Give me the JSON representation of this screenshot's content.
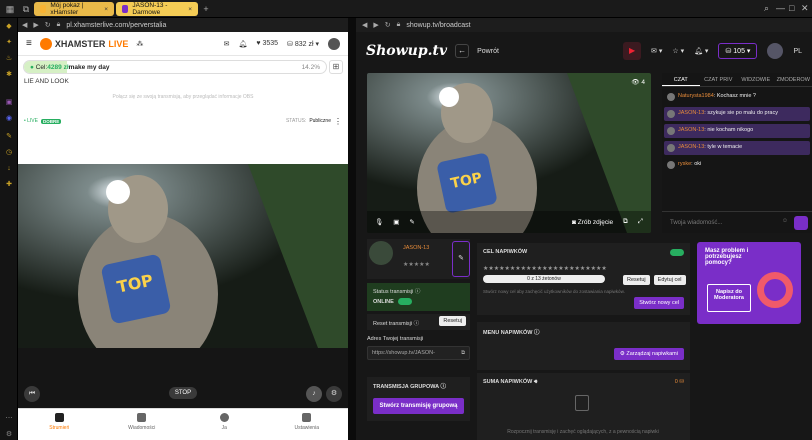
{
  "browser": {
    "tabs": [
      {
        "label": "Mój pokaz | xHamster",
        "close": "×"
      },
      {
        "label": "JASON-13 - Darmowe",
        "close": "×"
      }
    ],
    "left_url": "pl.xhamsterlive.com/perverstalia",
    "right_url": "showup.tv/broadcast"
  },
  "xh": {
    "logo_a": "XHAMSTER",
    "logo_b": "LIVE",
    "likes": "3535",
    "tokens": "832 zł",
    "goal_label": "Cel: ",
    "goal_amount": "4289 zł",
    "goal_text": " make my day",
    "goal_pct": "14.2%",
    "topic": "LIE AND LOOK",
    "notice": "Połącz się ze swoją transmisją, aby przeglądać informacje OBS",
    "live": "• LIVE",
    "quality": "DOBRE",
    "status_label": "STATUS: ",
    "status_value": "Publiczne",
    "stop": "STOP",
    "nav": [
      "Strumień",
      "Wiadomości",
      "Ja",
      "Ustawienia"
    ]
  },
  "su": {
    "logo": "Showup.tv",
    "back": "Powrót",
    "coins": "105",
    "lang": "PL",
    "viewers": "4",
    "snapshot": "Zrób zdjęcie",
    "chat_tabs": [
      "CZAT",
      "CZAT PRIV",
      "WIDZOWIE",
      "ZMODEROW"
    ],
    "messages": [
      {
        "user": "Naturysta1984",
        "text": ": Kochasz mnie ?",
        "hl": false
      },
      {
        "user": "JASON-13",
        "text": ": szykuje sie po malu do pracy",
        "hl": true
      },
      {
        "user": "JASON-13",
        "text": ": nie kocham nikogo",
        "hl": true
      },
      {
        "user": "JASON-13",
        "text": ": tyle w temacie",
        "hl": true
      },
      {
        "user": "ryske",
        "text": ": oki",
        "hl": false
      }
    ],
    "chat_placeholder": "Twoja wiadomość...",
    "profile_name": "JASON-13",
    "profile_stars": "★★★★★",
    "status_label": "Status transmisji",
    "status_value": "ONLINE",
    "reset_label": "Reset transmisji",
    "reset_btn": "Resetuj",
    "addr_label": "Adres Twojej transmisji",
    "addr_value": "https://showup.tv/JASON-",
    "group_label": "TRANSMISJA GRUPOWA",
    "group_btn": "Stwórz transmisję grupową",
    "goal_title": "CEL NAPIWKÓW",
    "goal_stars": "★★★★★★★★★★★★★★★★★★★★★★★",
    "goal_progress": "0 z 13 żetonów",
    "goal_reset": "Resetuj",
    "goal_edit": "Edytuj cel",
    "goal_hint": "Stwórz nowy cel aby zachęcić użytkowników do zostawiania napiwków.",
    "goal_new": "Stwórz nowy cel",
    "menu_title": "MENU NAPIWKÓW",
    "menu_btn": "Zarządzaj napiwkami",
    "sum_title": "SUMA NAPIWKÓW",
    "sum_amount": "0",
    "sum_hint": "Rozpocznij transmisję i zachęć oglądających, z a pewnością napiwki",
    "promo_text": "Masz problem i potrzebujesz pomocy?",
    "promo_btn": "Napisz do Moderatora"
  }
}
